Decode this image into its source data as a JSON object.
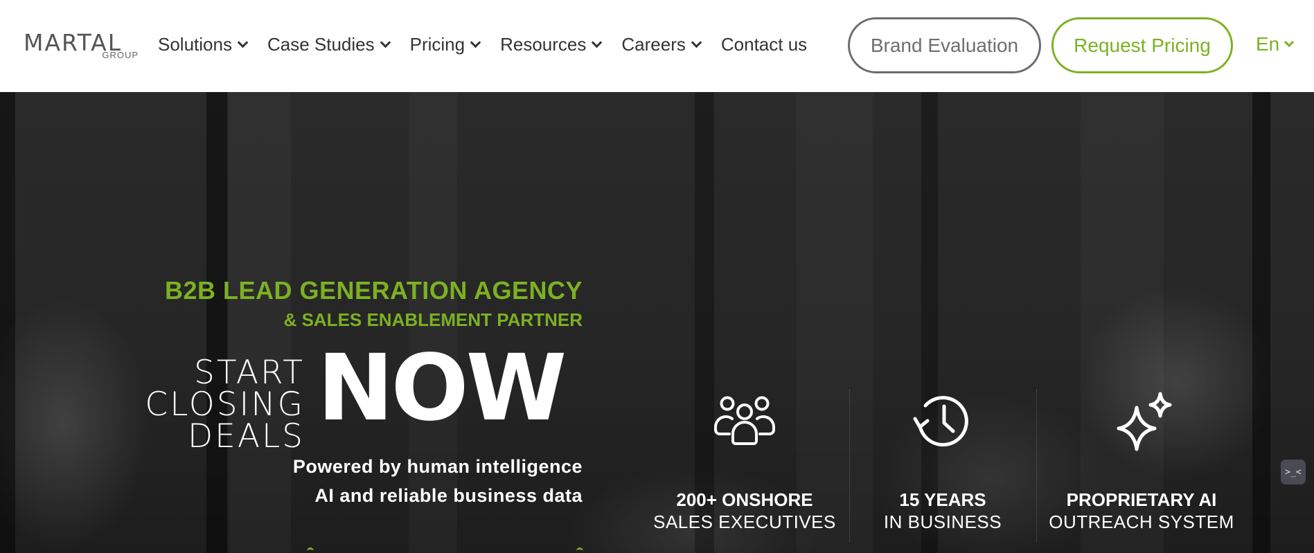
{
  "logo": {
    "word": "MARTAL",
    "sub": "GROUP"
  },
  "nav": {
    "items": [
      {
        "label": "Solutions",
        "dropdown": true
      },
      {
        "label": "Case Studies",
        "dropdown": true
      },
      {
        "label": "Pricing",
        "dropdown": true
      },
      {
        "label": "Resources",
        "dropdown": true
      },
      {
        "label": "Careers",
        "dropdown": true
      },
      {
        "label": "Contact us",
        "dropdown": false
      }
    ],
    "brand_button": "Brand Evaluation",
    "pricing_button": "Request Pricing",
    "language": "En"
  },
  "hero": {
    "kicker_main": "B2B LEAD GENERATION AGENCY",
    "kicker_sub": "& SALES ENABLEMENT PARTNER",
    "start_line1": "START CLOSING",
    "start_line2": "DEALS",
    "now": "NOW",
    "powered_line1": "Powered by human intelligence",
    "powered_line2": "AI and reliable business data"
  },
  "stats": [
    {
      "icon": "team-icon",
      "bold": "200+ ONSHORE",
      "light": "SALES EXECUTIVES"
    },
    {
      "icon": "history-clock-icon",
      "bold": "15 YEARS",
      "light": "IN BUSINESS"
    },
    {
      "icon": "sparkles-icon",
      "bold": "PROPRIETARY AI",
      "light": "OUTREACH SYSTEM"
    }
  ],
  "chat_widget": {
    "icon": "chat-widget-icon",
    "label": ">_<"
  },
  "colors": {
    "accent": "#7cb123",
    "nav_text": "#333333",
    "hero_bg": "#262626",
    "outline_gray": "#6c6c6c"
  }
}
